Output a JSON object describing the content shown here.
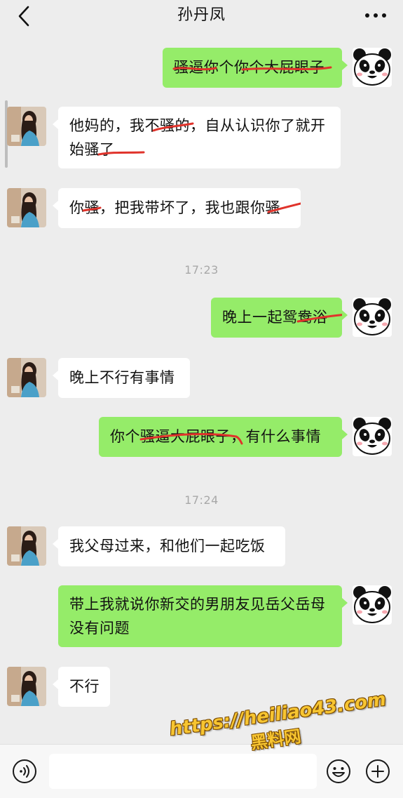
{
  "header": {
    "title": "孙丹凤",
    "back_icon": "chevron-left-icon",
    "more_icon": "more-dots-icon"
  },
  "colors": {
    "background": "#ededed",
    "sent_bubble": "#95ec69",
    "received_bubble": "#ffffff",
    "strike_red": "#e0332b",
    "timestamp": "#a8a8a8"
  },
  "messages": [
    {
      "side": "right",
      "segments": [
        {
          "t": "骚逼",
          "s": true
        },
        {
          "t": "你个你"
        },
        {
          "t": "个大屁眼子",
          "s": true
        }
      ]
    },
    {
      "side": "left",
      "segments": [
        {
          "t": "他妈的，我不"
        },
        {
          "t": "骚",
          "s": true
        },
        {
          "t": "的，自从认识你了就开始"
        },
        {
          "t": "骚了",
          "s": true
        }
      ]
    },
    {
      "side": "left",
      "segments": [
        {
          "t": "你"
        },
        {
          "t": "骚",
          "s": true
        },
        {
          "t": "，把我带坏了，我也跟你"
        },
        {
          "t": "骚",
          "s": true
        }
      ]
    },
    {
      "side": "right",
      "segments": [
        {
          "t": "晚上一起"
        },
        {
          "t": "鸳鸯浴",
          "s": true
        }
      ]
    },
    {
      "side": "left",
      "segments": [
        {
          "t": "晚上不行有事情"
        }
      ]
    },
    {
      "side": "right",
      "segments": [
        {
          "t": "你个"
        },
        {
          "t": "骚逼大屁眼子",
          "s": true
        },
        {
          "t": "，有什么事情"
        }
      ]
    },
    {
      "side": "left",
      "segments": [
        {
          "t": "我父母过来，和他们一起吃饭"
        }
      ]
    },
    {
      "side": "right",
      "segments": [
        {
          "t": "带上我就说你新交的男朋友见岳父岳母没有问题"
        }
      ]
    },
    {
      "side": "left",
      "segments": [
        {
          "t": "不行"
        }
      ]
    }
  ],
  "timestamps": [
    "17:23",
    "17:24"
  ],
  "input_bar": {
    "placeholder": "",
    "value": "",
    "voice_icon": "voice-icon",
    "emoji_icon": "emoji-icon",
    "plus_icon": "plus-icon"
  },
  "watermark": {
    "url": "https://heiliao43.com",
    "name": "黑料网"
  }
}
